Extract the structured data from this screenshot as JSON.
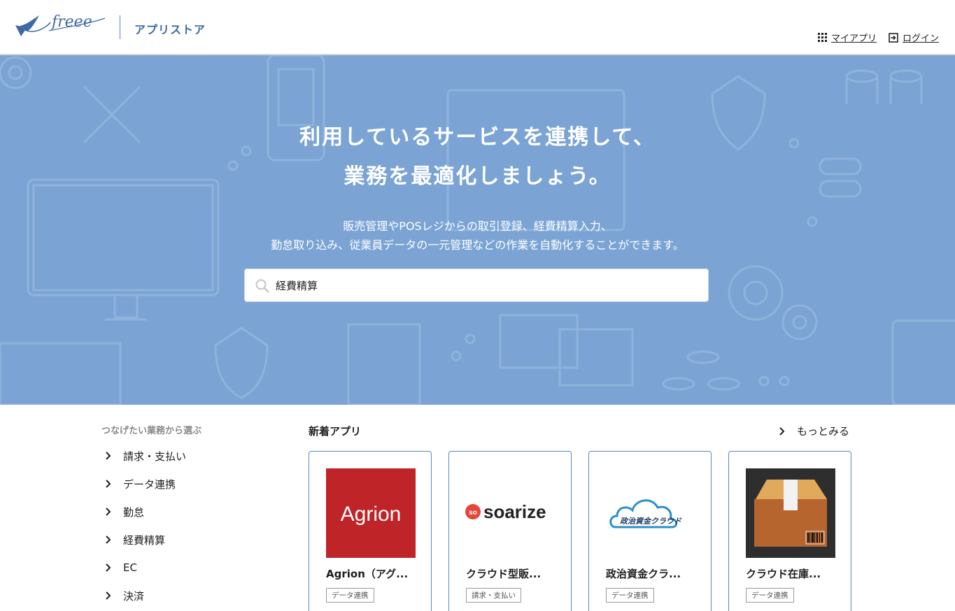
{
  "header": {
    "store_label": "アプリストア",
    "my_apps_label": "マイアプリ",
    "login_label": "ログイン"
  },
  "hero": {
    "title_line1": "利用しているサービスを連携して、",
    "title_line2": "業務を最適化しましょう。",
    "desc_line1": "販売管理やPOSレジからの取引登録、経費精算入力、",
    "desc_line2": "勤怠取り込み、従業員データの一元管理などの作業を自動化することができます。",
    "search_value": "経費精算",
    "background_color": "#7ba4d4"
  },
  "sidebar": {
    "heading": "つなげたい業務から選ぶ",
    "items": [
      {
        "label": "請求・支払い"
      },
      {
        "label": "データ連携"
      },
      {
        "label": "勤怠"
      },
      {
        "label": "経費精算"
      },
      {
        "label": "EC"
      },
      {
        "label": "決済"
      }
    ]
  },
  "new_apps": {
    "title": "新着アプリ",
    "more_label": "もっとみる",
    "cards": [
      {
        "name": "Agrion（アグ...",
        "tag": "データ連携",
        "logo_text": "Agrion",
        "logo_icon": "agrion-logo",
        "logo_bg": "#be2428"
      },
      {
        "name": "クラウド型販...",
        "tag": "請求・支払い",
        "logo_text": "soarize",
        "logo_icon": "soarize-logo"
      },
      {
        "name": "政治資金クラ...",
        "tag": "データ連携",
        "logo_text": "政治資金クラウド",
        "logo_icon": "cloud-logo"
      },
      {
        "name": "クラウド在庫...",
        "tag": "データ連携",
        "logo_icon": "box-logo",
        "logo_bg": "#2e2e2e"
      }
    ]
  },
  "colors": {
    "brand": "#3f6aa6",
    "card_border": "#5b88c4"
  }
}
